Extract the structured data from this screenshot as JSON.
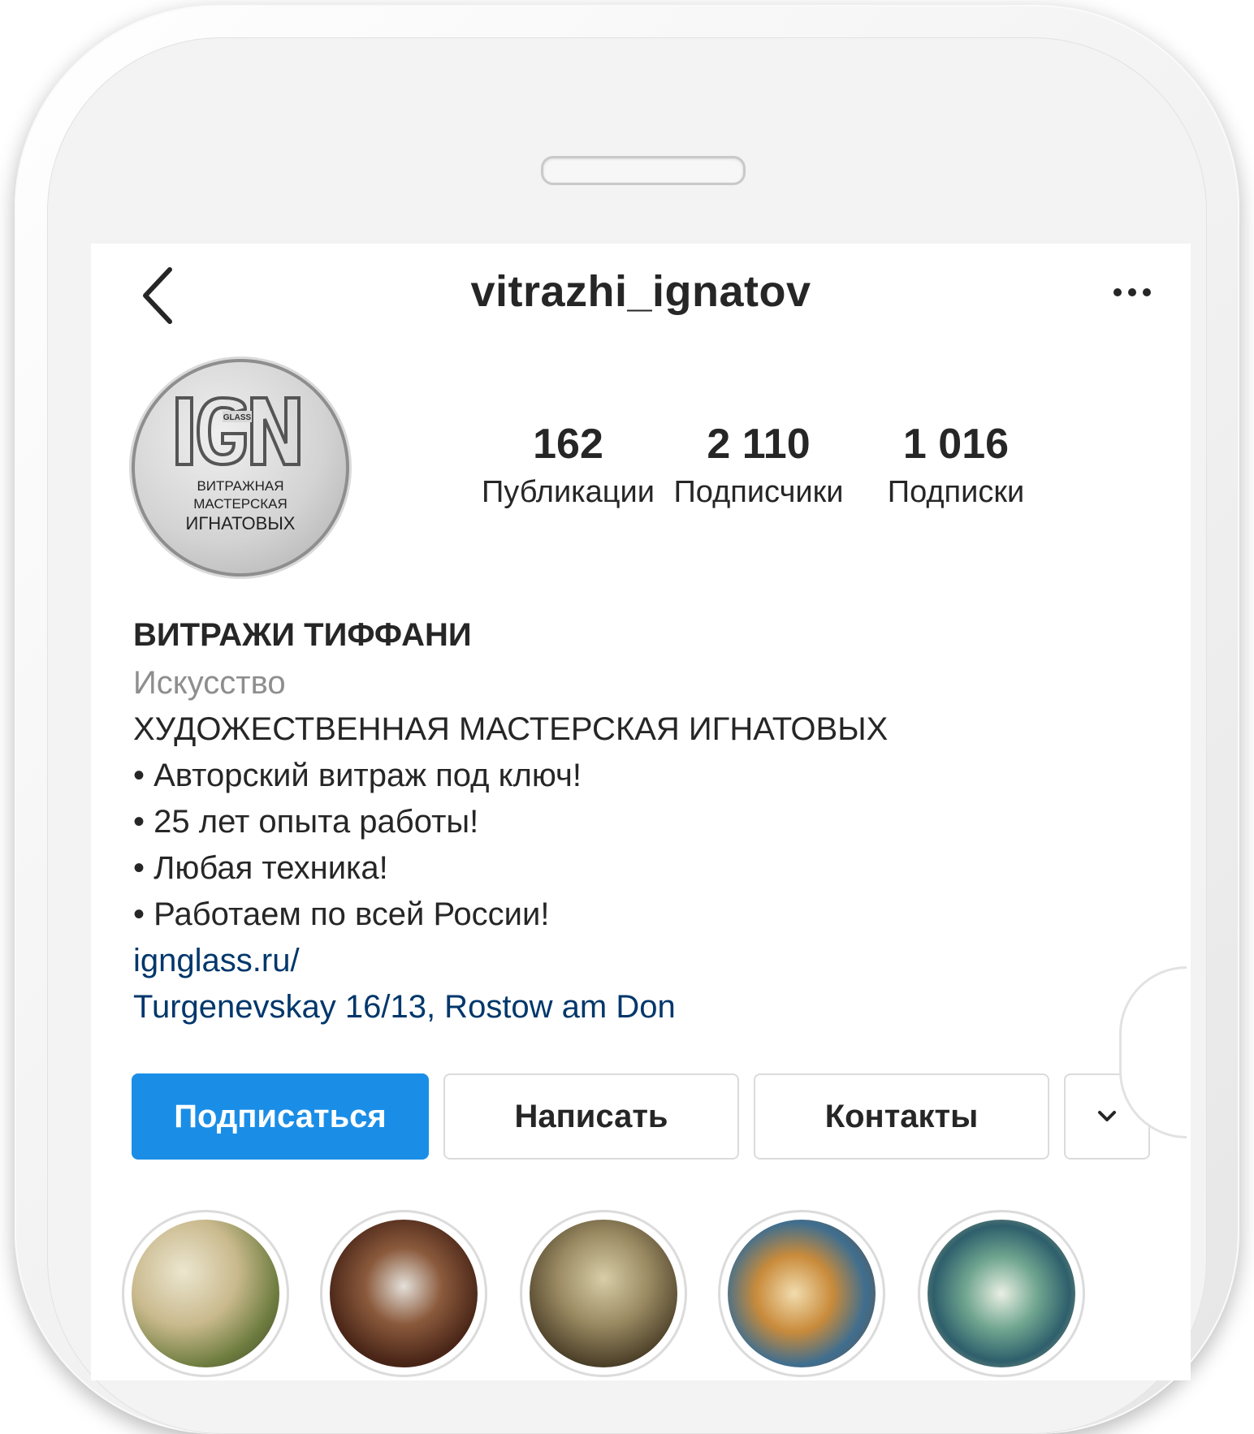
{
  "header": {
    "username": "vitrazhi_ignatov"
  },
  "avatar": {
    "logo_text": "IGN",
    "logo_small": "GLASS",
    "caption_lines": [
      "ВИТРАЖНАЯ",
      "МАСТЕРСКАЯ",
      "ИГНАТОВЫХ"
    ]
  },
  "stats": [
    {
      "value": "162",
      "label": "Публикации"
    },
    {
      "value": "2 110",
      "label": "Подписчики"
    },
    {
      "value": "1 016",
      "label": "Подписки"
    }
  ],
  "bio": {
    "name": "ВИТРАЖИ ТИФФАНИ",
    "category": "Искусство",
    "lines": [
      "ХУДОЖЕСТВЕННАЯ МАСТЕРСКАЯ ИГНАТОВЫХ",
      "• Авторский витраж под ключ!",
      "• 25 лет опыта работы!",
      "• Любая техника!",
      "• Работаем по всей России!"
    ],
    "website": "ignglass.ru/",
    "address": "Turgenevskay 16/13, Rostow am Don"
  },
  "buttons": {
    "follow": "Подписаться",
    "message": "Написать",
    "contacts": "Контакты"
  },
  "icons": {
    "back": "chevron-left-icon",
    "more": "more-horizontal-icon",
    "dropdown": "chevron-down-icon"
  },
  "colors": {
    "accent": "#1a8ee7",
    "link": "#00376b",
    "text": "#262626",
    "secondary": "#8e8e8e"
  }
}
